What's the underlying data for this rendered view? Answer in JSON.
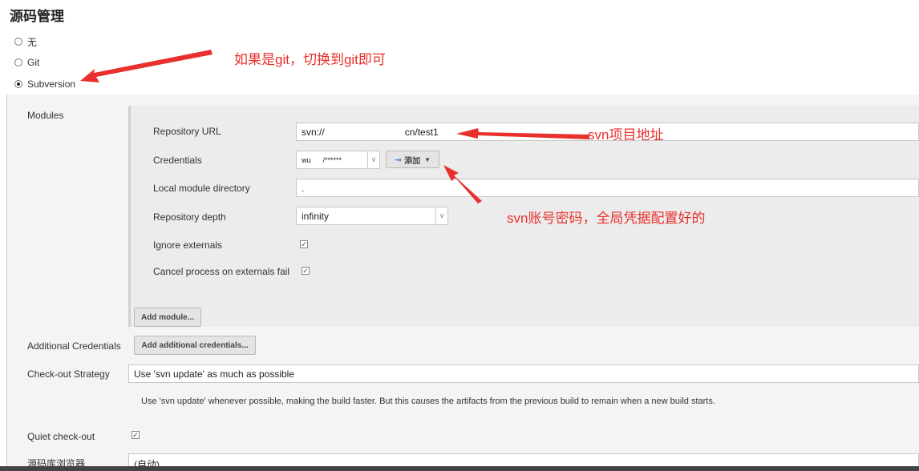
{
  "section_title": "源码管理",
  "scm_options": [
    {
      "label": "无",
      "selected": false
    },
    {
      "label": "Git",
      "selected": false
    },
    {
      "label": "Subversion",
      "selected": true
    }
  ],
  "modules": {
    "label": "Modules",
    "repository_url": {
      "label": "Repository URL",
      "value": "svn://                              cn/test1"
    },
    "credentials": {
      "label": "Credentials",
      "value": "wu      /******",
      "add_label": "添加"
    },
    "local_module_directory": {
      "label": "Local module directory",
      "value": "."
    },
    "repository_depth": {
      "label": "Repository depth",
      "value": "infinity"
    },
    "ignore_externals": {
      "label": "Ignore externals",
      "checked": true
    },
    "cancel_process": {
      "label": "Cancel process on externals fail",
      "checked": true
    },
    "add_module_label": "Add module..."
  },
  "additional_credentials": {
    "label": "Additional Credentials",
    "button_label": "Add additional credentials..."
  },
  "checkout_strategy": {
    "label": "Check-out Strategy",
    "value": "Use 'svn update' as much as possible",
    "description": "Use 'svn update' whenever possible, making the build faster. But this causes the artifacts from the previous build to remain when a new build starts."
  },
  "quiet_checkout": {
    "label": "Quiet check-out",
    "checked": true
  },
  "repo_browser": {
    "label": "源码库浏览器",
    "value": "(自动)"
  },
  "annotations": {
    "git_note": "如果是git，切换到git即可",
    "svn_url_note": "svn项目地址",
    "svn_cred_note": "svn账号密码，全局凭据配置好的"
  },
  "colors": {
    "annotation": "#e8302c"
  }
}
